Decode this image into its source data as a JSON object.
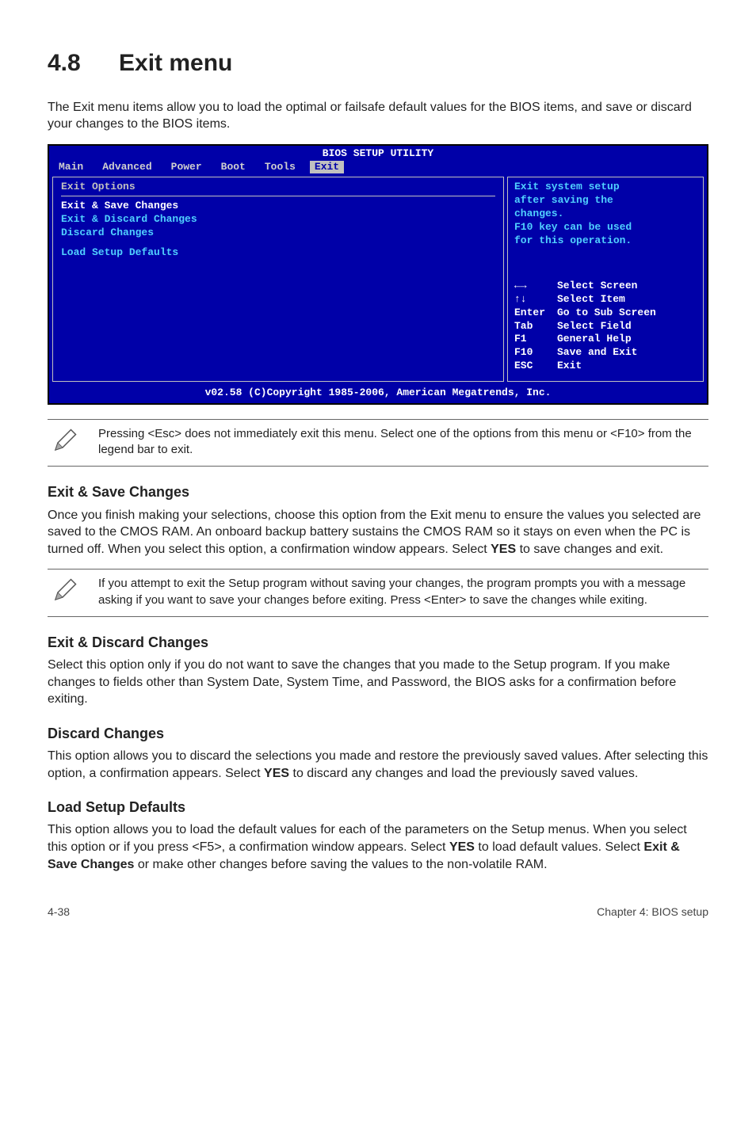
{
  "heading": {
    "number": "4.8",
    "title": "Exit menu"
  },
  "intro": "The Exit menu items allow you to load the optimal or failsafe default values for the BIOS items, and save or discard your changes to the BIOS items.",
  "bios": {
    "title": "BIOS SETUP UTILITY",
    "menu": [
      "Main",
      "Advanced",
      "Power",
      "Boot",
      "Tools",
      "Exit"
    ],
    "active_menu": "Exit",
    "left_title": "Exit Options",
    "items": [
      "Exit & Save Changes",
      "Exit & Discard Changes",
      "Discard Changes",
      "Load Setup Defaults"
    ],
    "help_text": [
      "Exit system setup",
      "after saving the",
      "changes.",
      "",
      "F10 key can be used",
      "for this operation."
    ],
    "keys": [
      {
        "k": "←→",
        "d": "Select Screen"
      },
      {
        "k": "↑↓",
        "d": "Select Item"
      },
      {
        "k": "Enter",
        "d": "Go to Sub Screen"
      },
      {
        "k": "Tab",
        "d": "Select Field"
      },
      {
        "k": "F1",
        "d": "General Help"
      },
      {
        "k": "F10",
        "d": "Save and Exit"
      },
      {
        "k": "ESC",
        "d": "Exit"
      }
    ],
    "footer": "v02.58 (C)Copyright 1985-2006, American Megatrends, Inc."
  },
  "note1": "Pressing <Esc> does not immediately exit this menu. Select one of the options from this menu or <F10> from the legend bar to exit.",
  "sections": {
    "s1": {
      "h": "Exit & Save Changes",
      "p_before": "Once you finish making your selections, choose this option from the Exit menu to ensure the values you selected are saved to the CMOS RAM. An onboard backup battery sustains the CMOS RAM so it stays on even when the PC is turned off. When you select this option, a confirmation window appears. Select ",
      "bold": "YES",
      "p_after": " to save changes and exit."
    },
    "s2": {
      "h": "Exit & Discard Changes",
      "p": "Select this option only if you do not want to save the changes that you made to the Setup program. If you make changes to fields other than System Date, System Time, and Password, the BIOS asks for a confirmation before exiting."
    },
    "s3": {
      "h": "Discard Changes",
      "p_before": "This option allows you to discard the selections you made and restore the previously saved values. After selecting this option, a confirmation appears. Select ",
      "bold": "YES",
      "p_after": " to discard any changes and load the previously saved values."
    },
    "s4": {
      "h": "Load Setup Defaults",
      "p_before": "This option allows you to load the default values for each of the parameters on the Setup menus. When you select this option or if you press <F5>, a confirmation window appears. Select ",
      "bold1": "YES",
      "p_mid": " to load default values. Select ",
      "bold2": "Exit & Save Changes",
      "p_after": " or make other changes before saving the values to the non-volatile RAM."
    }
  },
  "note2": "If you attempt to exit the Setup program without saving your changes, the program prompts you with a message asking if you want to save your changes before exiting. Press <Enter> to save the changes while exiting.",
  "footer": {
    "left": "4-38",
    "right": "Chapter 4: BIOS setup"
  }
}
